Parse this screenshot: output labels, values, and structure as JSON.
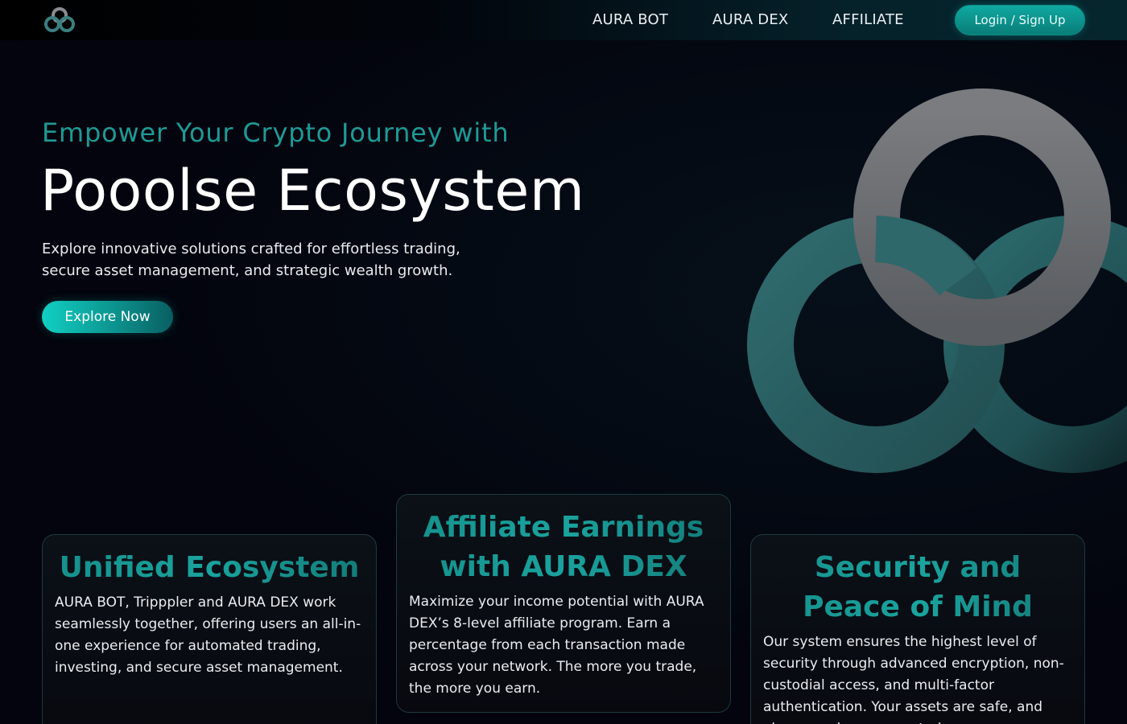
{
  "header": {
    "logo_icon": "interlinked-rings-icon",
    "nav": [
      {
        "label": "AURA BOT"
      },
      {
        "label": "AURA DEX"
      },
      {
        "label": "AFFILIATE"
      }
    ],
    "login_label": "Login / Sign Up"
  },
  "hero": {
    "eyebrow": "Empower Your Crypto Journey with",
    "title": "Pooolse Ecosystem",
    "description": "Explore innovative solutions crafted for effortless trading, secure asset management, and strategic wealth growth.",
    "cta_label": "Explore Now",
    "illustration_icon": "interlinked-rings-graphic"
  },
  "cards": [
    {
      "title": "Unified Ecosystem",
      "text": "AURA BOT, Tripppler and AURA DEX work seamlessly together, offering users an all-in-one experience for automated trading, investing, and secure asset management."
    },
    {
      "title": "Affiliate Earnings with AURA DEX",
      "text": "Maximize your income potential with AURA DEX’s 8-level affiliate program. Earn a percentage from each transaction made across your network. The more you trade, the more you earn."
    },
    {
      "title": "Security and Peace of Mind",
      "text": "Our system ensures the highest level of security through advanced encryption, non-custodial access, and multi-factor authentication. Your assets are safe, and always under your control."
    }
  ],
  "colors": {
    "accent": "#1f9a95",
    "button": "#0fa9a1",
    "ring_teal": "#2a6266",
    "ring_gray": "#6e7074",
    "background": "#03040d"
  }
}
